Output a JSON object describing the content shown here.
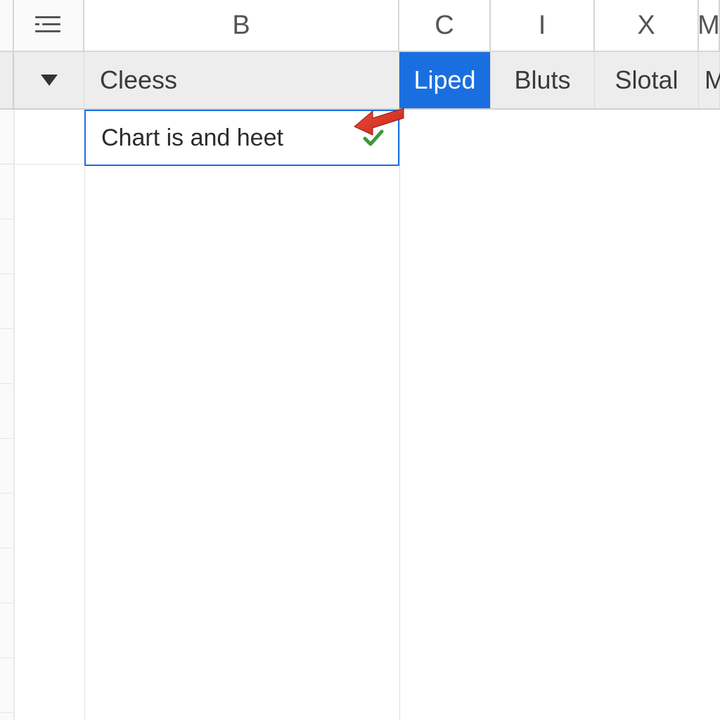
{
  "column_headers": {
    "b": "B",
    "c": "C",
    "i": "I",
    "x": "X",
    "m": "M"
  },
  "header_row": {
    "b": "Cleess",
    "c": "Liped",
    "i": "Bluts",
    "x": "Slotal",
    "m": "M",
    "selected_column": "c"
  },
  "active_cell": {
    "value": "Chart is and heet"
  },
  "colors": {
    "selection_blue": "#1a6fe0",
    "arrow_red": "#e0372a",
    "checkmark_green": "#3d9a3a"
  }
}
